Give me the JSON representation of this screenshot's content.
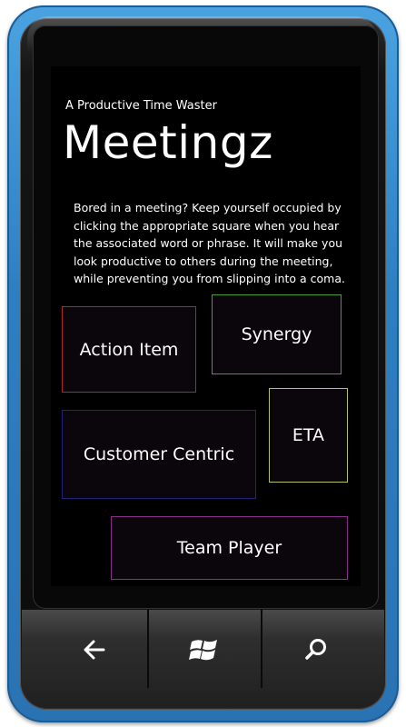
{
  "app": {
    "subtitle": "A Productive Time Waster",
    "title": "Meetingz",
    "description": "Bored in a meeting?  Keep yourself occupied by clicking the appropriate square when you hear the associated word or phrase.  It will make you look productive to others during the meeting, while preventing you from slipping into a coma."
  },
  "tiles": [
    {
      "label": "Action Item",
      "border": "#b0242a"
    },
    {
      "label": "Synergy",
      "border": "#4a9a3a"
    },
    {
      "label": "ETA",
      "border": "#b7c064"
    },
    {
      "label": "Customer Centric",
      "border": "#23237a"
    },
    {
      "label": "Team Player",
      "border": "#8a2e8a"
    }
  ],
  "hardware_buttons": [
    {
      "name": "back",
      "icon": "back-arrow-icon"
    },
    {
      "name": "start",
      "icon": "windows-logo-icon"
    },
    {
      "name": "search",
      "icon": "search-icon"
    }
  ],
  "colors": {
    "phone_frame": "#2f7fc0",
    "screen_background": "#000000",
    "text": "#ffffff"
  }
}
